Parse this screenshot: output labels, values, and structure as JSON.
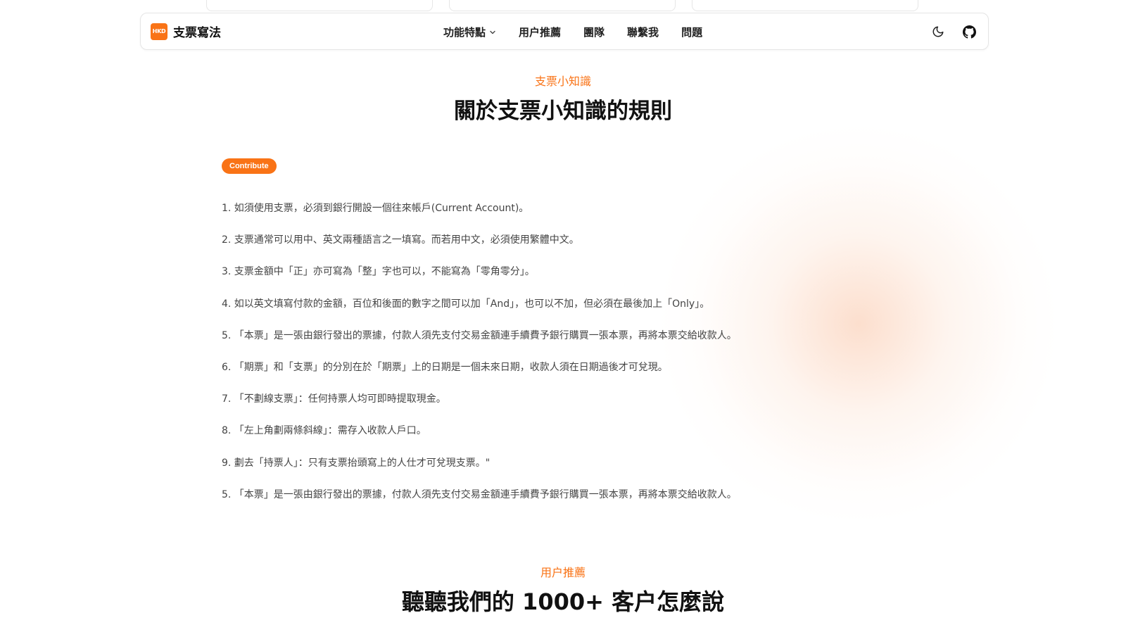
{
  "navbar": {
    "brand_logo_text": "HKD",
    "brand_name": "支票寫法",
    "links": [
      {
        "label": "功能特點",
        "has_dropdown": true
      },
      {
        "label": "用户推薦"
      },
      {
        "label": "團隊"
      },
      {
        "label": "聯繫我"
      },
      {
        "label": "問題"
      }
    ],
    "icons": [
      "moon-icon",
      "github-icon"
    ]
  },
  "rules_section": {
    "kicker": "支票小知識",
    "title": "關於支票小知識的規則",
    "badge": "Contribute",
    "items": [
      "1. 如須使用支票，必須到銀行開設一個往來帳戶(Current Account)。",
      "2. 支票通常可以用中、英文兩種語言之一填寫。而若用中文，必須使用繁體中文。",
      "3. 支票金額中「正」亦可寫為「整」字也可以，不能寫為「零角零分」。",
      "4. 如以英文填寫付款的金額，百位和後面的數字之間可以加「And」，也可以不加，但必須在最後加上「Only」。",
      "5. 「本票」是一張由銀行發出的票據，付款人須先支付交易金額連手續費予銀行購買一張本票，再將本票交給收款人。",
      "6. 「期票」和「支票」的分別在於「期票」上的日期是一個未來日期，收款人須在日期過後才可兌現。",
      "7. 「不劃線支票」：任何持票人均可即時提取現金。",
      "8. 「左上角劃兩條斜線」：需存入收款人戶口。",
      "9. 劃去「持票人」：只有支票抬頭寫上的人仕才可兌現支票。\"",
      "5. 「本票」是一張由銀行發出的票據，付款人須先支付交易金額連手續費予銀行購買一張本票，再將本票交給收款人。"
    ]
  },
  "testimonials_section": {
    "kicker": "用户推薦",
    "title": "聽聽我們的 1000+ 客户怎麼說"
  },
  "colors": {
    "accent": "#f97316",
    "text": "#222222",
    "muted_text": "#444444",
    "border": "#e5e5e5"
  }
}
